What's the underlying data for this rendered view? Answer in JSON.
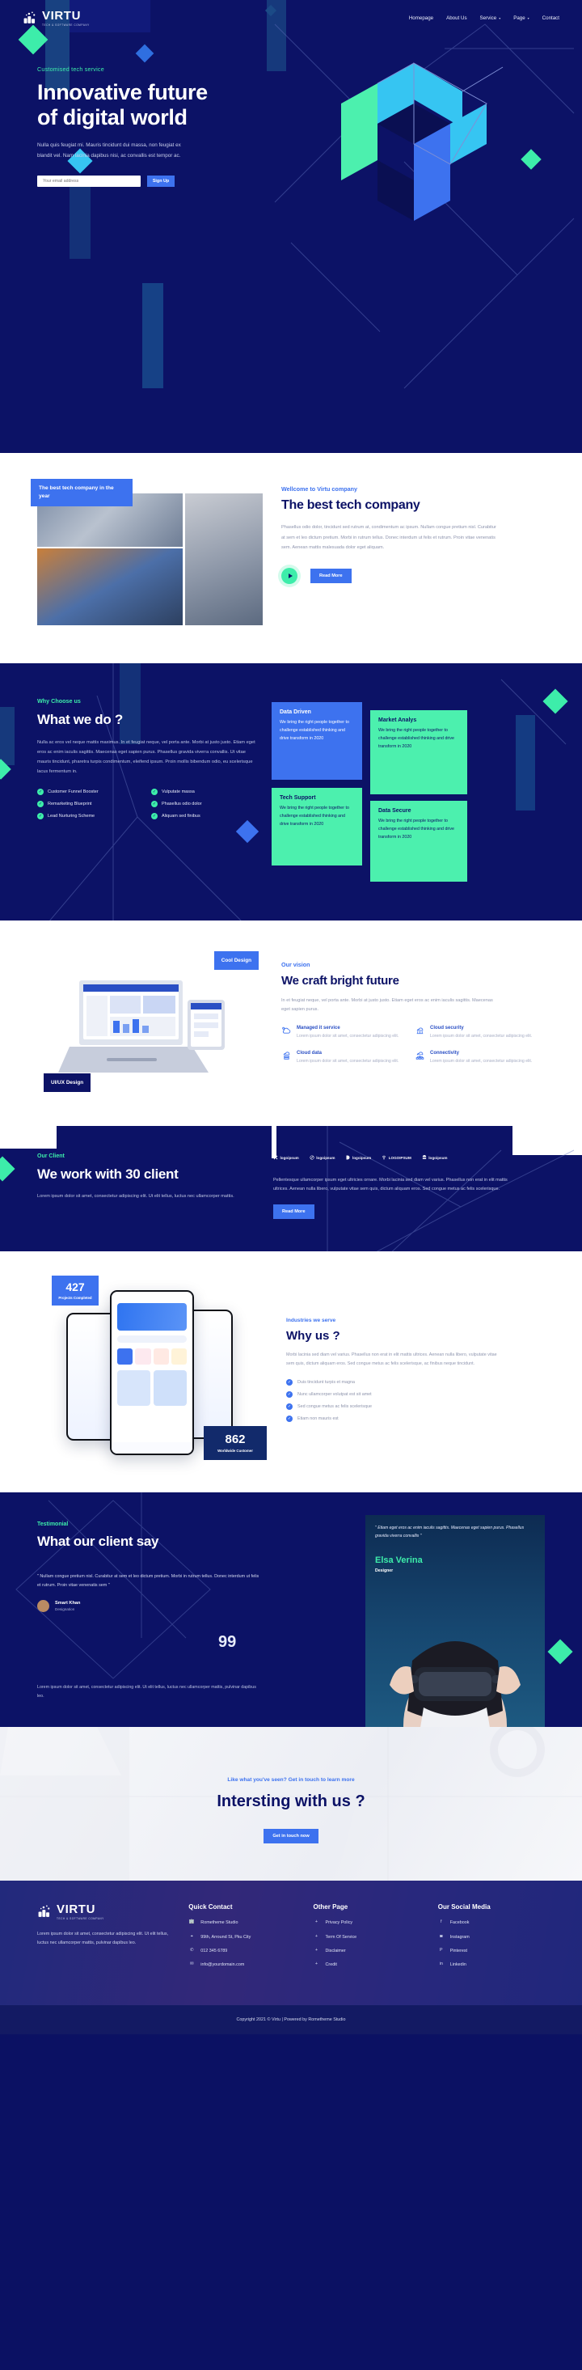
{
  "brand": {
    "name": "VIRTU",
    "tagline": "TECH & SOFTWARE COMPANY"
  },
  "nav": [
    {
      "label": "Homepage",
      "caret": false
    },
    {
      "label": "About Us",
      "caret": false
    },
    {
      "label": "Service",
      "caret": true
    },
    {
      "label": "Page",
      "caret": true
    },
    {
      "label": "Contact",
      "caret": false
    }
  ],
  "hero": {
    "eyebrow": "Customised tech service",
    "title": "Innovative future of digital world",
    "paragraph": "Nulla quis feugiat mi. Mauris tincidunt dui massa, non feugiat ex blandit vel. Nam lacinia dapibus nisi, ac convallis est tempor ac.",
    "email_placeholder": "Your email address",
    "signup_label": "Sign Up"
  },
  "about": {
    "badge": "The best tech company in the year",
    "eyebrow": "Wellcome to Virtu company",
    "title": "The best tech company",
    "paragraph": "Phasellus odio dolor, tincidunt sed rutrum at, condimentum ac ipsum. Nullam congue pretium nisl. Curabitur at sem et leo dictum pretium. Morbi in rutrum tellus. Donec interdum ut felis et rutrum. Proin vitae venenatis sem. Aenean mattis malesuada dolor eget aliquam.",
    "button": "Read More"
  },
  "whatwedo": {
    "eyebrow": "Why Choose us",
    "title": "What we do ?",
    "paragraph": "Nulla ac eros vel neque mattis maximus. In et feugiat neque, vel porta ante. Morbi at justo justo. Etiam eget eros ac enim iaculis sagittis. Maecenas eget sapien purus. Phasellus gravida viverra convallis. Ut vitae mauris tincidunt, pharetra turpis condimentum, eleifend ipsum. Proin mollis bibendum odio, eu scelerisque lacus fermentum in.",
    "checklist": [
      "Customer Funnel Booster",
      "Vulputate massa",
      "Remarketing Blueprint",
      "Phasellus odio dolor",
      "Lead Nurturing Scheme",
      "Aliquam sed finibus"
    ],
    "cards": [
      {
        "title": "Data Driven",
        "body": "We bring the right people together to challenge established thinking and drive transform in 2020"
      },
      {
        "title": "Market Analys",
        "body": "We bring the right people together to challenge established thinking and drive transform in 2020"
      },
      {
        "title": "Tech Support",
        "body": "We bring the right people together to challenge established thinking and drive transform in 2020"
      },
      {
        "title": "Data Secure",
        "body": "We bring the right people together to challenge established thinking and drive transform in 2020"
      }
    ]
  },
  "vision": {
    "badge_top": "Cool Design",
    "badge_bottom": "UI/UX Design",
    "eyebrow": "Our vision",
    "title": "We craft bright future",
    "paragraph": "In et feugiat neque, vel porta ante. Morbi at justo justo. Etiam eget eros ac enim iaculis sagittis. Maecenas eget sapien purus.",
    "features": [
      {
        "icon": "cloud-service-icon",
        "title": "Managed it service",
        "body": "Lorem ipsum dolor sit amet, consectetur adipiscing elit."
      },
      {
        "icon": "cloud-security-icon",
        "title": "Cloud security",
        "body": "Lorem ipsum dolor sit amet, consectetur adipiscing elit."
      },
      {
        "icon": "cloud-data-icon",
        "title": "Cloud data",
        "body": "Lorem ipsum dolor sit amet, consectetur adipiscing elit."
      },
      {
        "icon": "connectivity-icon",
        "title": "Connectivity",
        "body": "Lorem ipsum dolor sit amet, consectetur adipiscing elit."
      }
    ]
  },
  "client": {
    "eyebrow": "Our Client",
    "title": "We work with 30 client",
    "paragraph": "Lorem ipsum dolor sit amet, consectetur adipiscing elit. Ut elit tellus, luctus nec ullamcorper mattis.",
    "logos": [
      "logoipsum",
      "logoipsum",
      "logoipsum",
      "LOGOIPSUM",
      "logoipsum"
    ],
    "right_paragraph": "Pellentesque ullamcorper ipsum eget ultricies ornare. Morbi lacinia sed diam vel varius. Phasellus non erat in elit mattis ultrices. Aenean nulla libero, vulputate vitae sem quis, dictum aliquam eros. Sed congue metus ac felis scelerisque.",
    "button": "Read More"
  },
  "why": {
    "stat_top_number": "427",
    "stat_top_label": "Projects Completed",
    "stat_bottom_number": "862",
    "stat_bottom_label": "Worldwide Customer",
    "eyebrow": "Industries we serve",
    "title": "Why us ?",
    "paragraph": "Morbi lacinia sed diam vel varius. Phasellus non erat in elit mattis ultrices. Aenean nulla libero, vulputate vitae sem quis, dictum aliquam eros. Sed congue metus ac felis scelerisque, ac finibus neque tincidunt.",
    "checklist": [
      "Duis tincidunt turpis et magna",
      "Nunc ullamcorper volutpat est sit amet",
      "Sed congue metus ac felis scelerisque",
      "Etiam non mauris est"
    ]
  },
  "testimonial": {
    "eyebrow": "Testimonial",
    "title": "What our client say",
    "quote": "\" Nullam congue pretium nisl. Curabitur at sem et leo dictum pretium. Morbi in rutrum tellus. Donec interdum ut felis et rutrum. Proin vitae venenatis sem \"",
    "author_name": "Smart Khan",
    "author_role": "Designation",
    "quote_mark": "99",
    "bottom_paragraph": "Lorem ipsum dolor sit amet, consectetur adipiscing elit. Ut elit tellus, luctus nec ullamcorper mattis, pulvinar dapibus leo.",
    "feature_quote": "\" Etiam eget eros ac enim iaculis sagittis. Maecenas eget sapien purus. Phasellus gravida viverra convallis \"",
    "feature_name": "Elsa Verina",
    "feature_role": "Designer"
  },
  "cta": {
    "eyebrow": "Like what you've seen? Get in touch to learn more",
    "title": "Intersting with us ?",
    "button": "Get in touch now"
  },
  "footer": {
    "about_text": "Lorem ipsum dolor sit amet, consectetur adipiscing elit. Ut elit tellus, luctus nec ullamcorper mattis, pulvinar dapibus leo.",
    "contact_title": "Quick Contact",
    "contact": [
      {
        "icon": "building-icon",
        "text": "Rometheme Studio"
      },
      {
        "icon": "location-pin-icon",
        "text": "99th, Arround St, Pku City"
      },
      {
        "icon": "phone-icon",
        "text": "012 345 6789"
      },
      {
        "icon": "mail-icon",
        "text": "info@yourdomain.com"
      }
    ],
    "other_title": "Other Page",
    "other": [
      "Privacy Policy",
      "Term Of Service",
      "Disclaimer",
      "Credit"
    ],
    "social_title": "Our Social Media",
    "social": [
      {
        "icon": "facebook-icon",
        "label": "Facebook"
      },
      {
        "icon": "instagram-icon",
        "label": "Instagram"
      },
      {
        "icon": "pinterest-icon",
        "label": "Pinterest"
      },
      {
        "icon": "linkedin-icon",
        "label": "Linkedin"
      }
    ],
    "copyright": "Copyright 2021 © Virtu | Powered by Rometheme Studio"
  },
  "colors": {
    "navy": "#0c1266",
    "blue": "#3d72ef",
    "mint": "#3dedaa",
    "cyan": "#36c5f2"
  }
}
